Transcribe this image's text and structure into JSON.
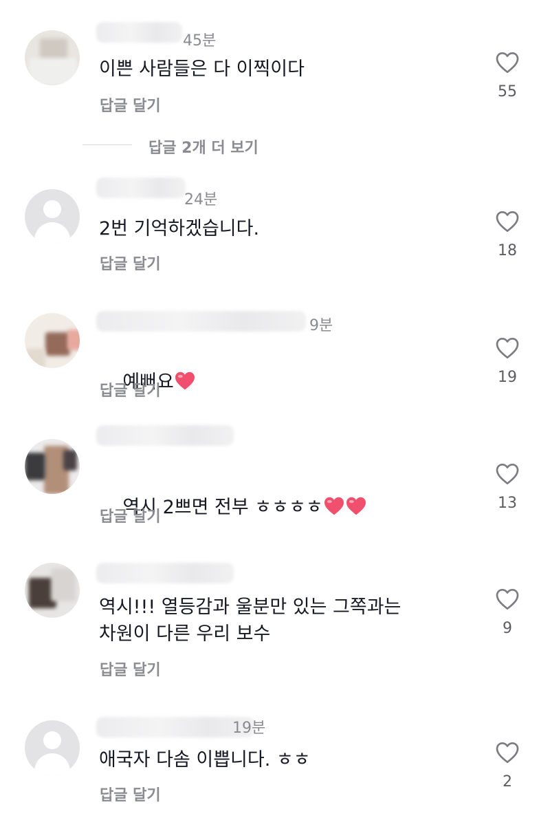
{
  "reply_label": "답글 달기",
  "more_replies_label": "답글 2개 더 보기",
  "comments": [
    {
      "time": "45분",
      "text": "이쁜 사람들은 다 이찍이다",
      "likes": "55"
    },
    {
      "time": "24분",
      "text": "2번 기억하겠습니다.",
      "likes": "18"
    },
    {
      "time": "9분",
      "text": "예뻐요",
      "likes": "19"
    },
    {
      "time": "",
      "text": "역시 2쁘면 전부 ㅎㅎㅎㅎ",
      "likes": "13"
    },
    {
      "time": "",
      "text_line1": "역시!!! 열등감과 울분만 있는 그쪽과는",
      "text_line2": "차원이 다른 우리 보수",
      "likes": "9"
    },
    {
      "time": "19분",
      "text": "애국자 다솜 이쁩니다. ㅎㅎ",
      "likes": "2"
    }
  ],
  "colors": {
    "heart_emoji": "#f0506e",
    "meta_gray": "#8a8b91",
    "text": "#161823"
  },
  "icons": {
    "like": "heart-outline-icon",
    "avatar_default": "default-avatar-icon"
  }
}
